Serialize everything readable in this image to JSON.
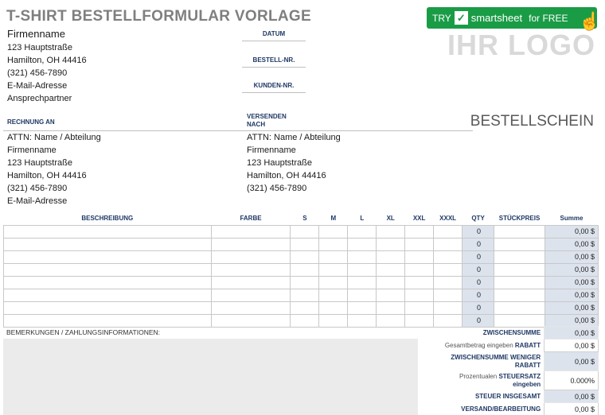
{
  "title": "T-SHIRT BESTELLFORMULAR VORLAGE",
  "sender": {
    "company": "Firmenname",
    "street": "123 Hauptstraße",
    "city": "Hamilton, OH 44416",
    "phone": "(321) 456-7890",
    "email": "E-Mail-Adresse",
    "contact": "Ansprechpartner"
  },
  "fields": {
    "date": "DATUM",
    "order_no": "BESTELL-NR.",
    "customer_no": "KUNDEN-NR."
  },
  "banner": {
    "try": "TRY",
    "brand": "smartsheet",
    "free": "for FREE"
  },
  "logo": "IHR LOGO",
  "form_title": "BESTELLSCHEIN",
  "bill_to": {
    "heading": "RECHNUNG AN",
    "attn": "ATTN: Name / Abteilung",
    "company": "Firmenname",
    "street": "123 Hauptstraße",
    "city": "Hamilton, OH 44416",
    "phone": "(321) 456-7890",
    "email": "E-Mail-Adresse"
  },
  "ship_to": {
    "heading1": "VERSENDEN",
    "heading2": "NACH",
    "attn": "ATTN: Name / Abteilung",
    "company": "Firmenname",
    "street": "123 Hauptstraße",
    "city": "Hamilton, OH 44416",
    "phone": "(321) 456-7890"
  },
  "table": {
    "headers": [
      "BESCHREIBUNG",
      "FARBE",
      "S",
      "M",
      "L",
      "XL",
      "XXL",
      "XXXL",
      "QTY",
      "STÜCKPREIS",
      "Summe"
    ],
    "rows": [
      {
        "qty": "0",
        "sum": "0,00 $"
      },
      {
        "qty": "0",
        "sum": "0,00 $"
      },
      {
        "qty": "0",
        "sum": "0,00 $"
      },
      {
        "qty": "0",
        "sum": "0,00 $"
      },
      {
        "qty": "0",
        "sum": "0,00 $"
      },
      {
        "qty": "0",
        "sum": "0,00 $"
      },
      {
        "qty": "0",
        "sum": "0,00 $"
      },
      {
        "qty": "0",
        "sum": "0,00 $"
      }
    ]
  },
  "remarks_label": "BEMERKUNGEN / ZAHLUNGSINFORMATIONEN:",
  "totals": {
    "subtotal_label": "ZWISCHENSUMME",
    "subtotal": "0,00 $",
    "discount_hint": "Gesamtbetrag eingeben",
    "discount_label": "RABATT",
    "discount": "0,00 $",
    "subtotal_less_1": "ZWISCHENSUMME WENIGER",
    "subtotal_less_2": "RABATT",
    "subtotal_less": "0,00 $",
    "tax_hint": "Prozentualen",
    "tax_label_1": "STEUERSATZ",
    "tax_label_2": "eingeben",
    "tax_rate": "0.000%",
    "tax_total_label": "STEUER INSGESAMT",
    "tax_total": "0,00 $",
    "shipping_label": "VERSAND/BEARBEITUNG",
    "shipping": "0,00 $"
  }
}
